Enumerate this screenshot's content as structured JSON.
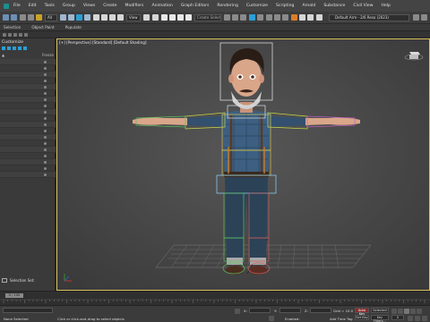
{
  "menubar": {
    "items": [
      "File",
      "Edit",
      "Tools",
      "Group",
      "Views",
      "Create",
      "Modifiers",
      "Animation",
      "Graph Editors",
      "Rendering",
      "Customize",
      "Scripting",
      "Arnold",
      "Substance",
      "Civil View",
      "Help"
    ]
  },
  "toolbar": {
    "filter_label": "All",
    "view_label": "View",
    "selection_set_placeholder": "Create Selection Se",
    "workspace_label": "Default Arm - 2/6 Reso (2023)"
  },
  "ribbon": {
    "tabs": [
      "Selection",
      "Object Paint",
      "Populate"
    ]
  },
  "scene_explorer": {
    "title": "Customize",
    "header_freeze": "Freeze",
    "rows": 19,
    "selection_set_label": "Selection Set:"
  },
  "viewport": {
    "label": "[+] [Perspective] [Standard] [Default Shading]"
  },
  "timeline": {
    "slider_label": "0 / 100",
    "ticks": [
      "0",
      "5",
      "10",
      "15",
      "20",
      "25",
      "30",
      "35",
      "40",
      "45",
      "50",
      "55",
      "60",
      "65",
      "70",
      "75",
      "80",
      "85",
      "90",
      "95",
      "100"
    ]
  },
  "statusbar": {
    "status_left": "None Selected",
    "prompt": "Click or click-and-drag to select objects",
    "x_label": "X:",
    "y_label": "Y:",
    "z_label": "Z:",
    "x_value": "",
    "y_value": "",
    "z_value": "",
    "grid_label": "Grid = 10.0",
    "enabled_label": "Enabled:",
    "add_time_tag": "Add Time Tag",
    "autokey_label": "Auto Key",
    "selected_label": "Selected",
    "setkey_label": "Set Key",
    "key_filters": "Key Filters...",
    "frame_value": "0"
  },
  "colors": {
    "viewport_border": "#d9c15a",
    "menubar": "#444444",
    "autokey": "#8b2a2a",
    "hero_icon": "#1d8f8f"
  }
}
